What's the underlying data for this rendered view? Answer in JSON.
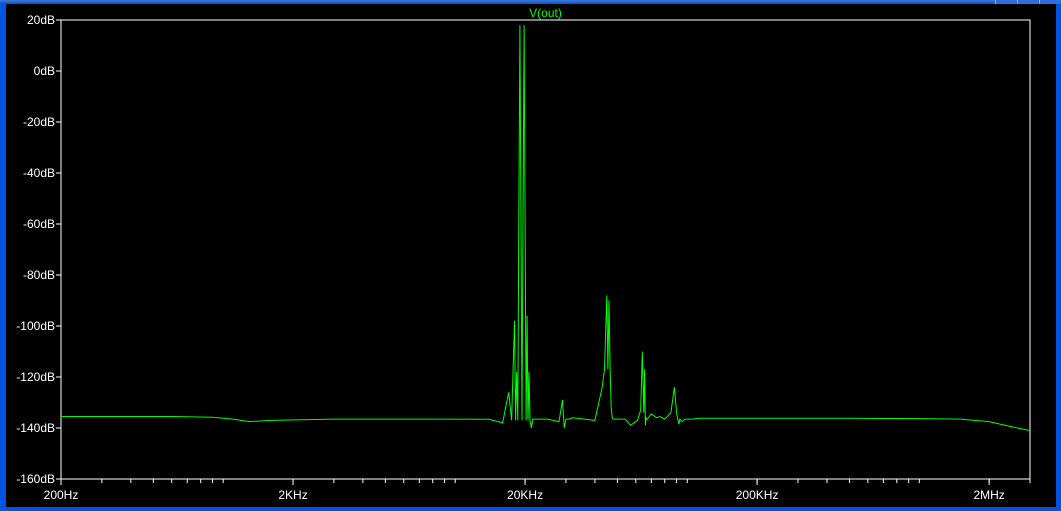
{
  "chart_data": {
    "type": "line",
    "title": "V(out)",
    "xscale": "log",
    "xlim": [
      200,
      3000000
    ],
    "ylim": [
      -160,
      20
    ],
    "x_ticks": [
      {
        "value": 200,
        "label": "200Hz"
      },
      {
        "value": 2000,
        "label": "2KHz"
      },
      {
        "value": 20000,
        "label": "20KHz"
      },
      {
        "value": 200000,
        "label": "200KHz"
      },
      {
        "value": 2000000,
        "label": "2MHz"
      }
    ],
    "y_ticks": [
      {
        "value": 20,
        "label": "20dB"
      },
      {
        "value": 0,
        "label": "0dB"
      },
      {
        "value": -20,
        "label": "-20dB"
      },
      {
        "value": -40,
        "label": "-40dB"
      },
      {
        "value": -60,
        "label": "-60dB"
      },
      {
        "value": -80,
        "label": "-80dB"
      },
      {
        "value": -100,
        "label": "-100dB"
      },
      {
        "value": -120,
        "label": "-120dB"
      },
      {
        "value": -140,
        "label": "-140dB"
      },
      {
        "value": -160,
        "label": "-160dB"
      }
    ],
    "grid": false,
    "colors": {
      "trace": "#00ff00",
      "axis": "#ffffff",
      "title": "#00ff00",
      "background": "#000000"
    },
    "series": [
      {
        "name": "V(out)",
        "x": [
          200,
          600,
          900,
          1100,
          1300,
          1600,
          3000,
          8000,
          14000,
          16000,
          17000,
          17500,
          18000,
          18200,
          18400,
          18600,
          18800,
          19000,
          19200,
          19400,
          19600,
          19800,
          20000,
          20200,
          20400,
          20600,
          20800,
          21000,
          21300,
          21600,
          22000,
          25000,
          28000,
          29000,
          29500,
          30000,
          31000,
          32000,
          36000,
          40000,
          43000,
          44000,
          45000,
          45500,
          46000,
          46500,
          47000,
          47500,
          48000,
          49000,
          50000,
          54000,
          57000,
          61000,
          63000,
          64000,
          65000,
          65500,
          66000,
          66500,
          67000,
          68000,
          70000,
          74000,
          76000,
          80000,
          85000,
          88000,
          90000,
          91000,
          92000,
          93000,
          95000,
          98000,
          100000,
          105000,
          110000,
          114000,
          200000,
          500000,
          1000000,
          1500000,
          2000000,
          2500000,
          3000000
        ],
        "y": [
          -135.5,
          -135.5,
          -135.8,
          -136.5,
          -137.5,
          -137.0,
          -136.5,
          -136.5,
          -136.6,
          -138.0,
          -126.0,
          -137.0,
          -98.0,
          -137.0,
          -118.0,
          -137.0,
          -59.0,
          18.0,
          -59.0,
          -137.0,
          -59.0,
          18.0,
          -59.0,
          -137.0,
          -96.0,
          -137.0,
          -118.0,
          -137.0,
          -140.0,
          -136.5,
          -136.5,
          -136.5,
          -137.5,
          -129.0,
          -140.0,
          -136.5,
          -136.5,
          -136.0,
          -136.5,
          -137.0,
          -124.0,
          -117.0,
          -88.0,
          -117.0,
          -90.0,
          -117.0,
          -132.0,
          -136.0,
          -136.5,
          -136.5,
          -136.5,
          -136.5,
          -139.0,
          -137.0,
          -133.0,
          -110.0,
          -134.0,
          -117.0,
          -139.0,
          -136.0,
          -136.5,
          -136.0,
          -134.5,
          -136.0,
          -135.5,
          -136.5,
          -134.0,
          -124.0,
          -134.0,
          -136.5,
          -138.5,
          -136.5,
          -137.5,
          -136.5,
          -136.5,
          -136.5,
          -136.3,
          -136.2,
          -136.2,
          -136.2,
          -136.3,
          -136.5,
          -137.5,
          -139.5,
          -141.0
        ]
      }
    ]
  }
}
